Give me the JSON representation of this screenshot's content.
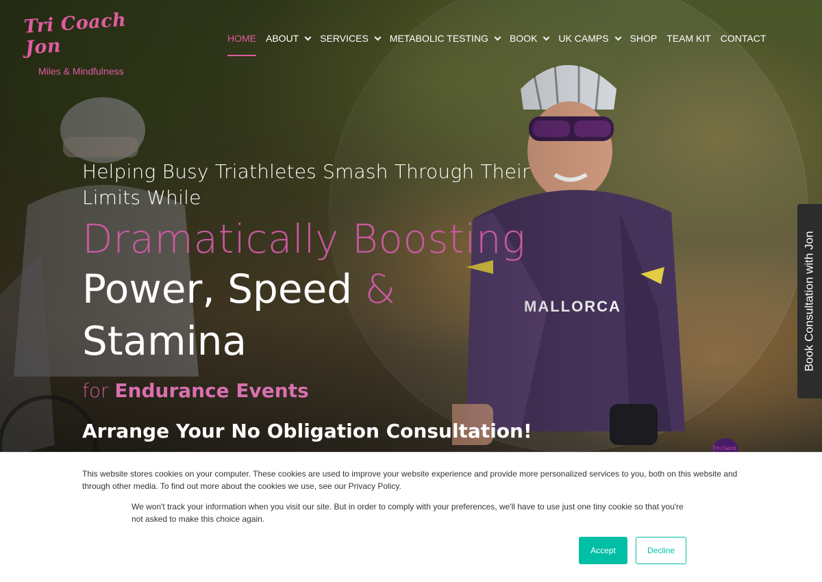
{
  "brand": {
    "logo_text": "Tri Coach Jon",
    "tagline": "Miles & Mindfulness",
    "accent": "#e05ca0",
    "accent_soft": "#c95aa0"
  },
  "nav": {
    "items": [
      {
        "label": "HOME",
        "active": true,
        "has_dropdown": false
      },
      {
        "label": "ABOUT",
        "active": false,
        "has_dropdown": true
      },
      {
        "label": "SERVICES",
        "active": false,
        "has_dropdown": true
      },
      {
        "label": "METABOLIC TESTING",
        "active": false,
        "has_dropdown": true
      },
      {
        "label": "BOOK",
        "active": false,
        "has_dropdown": true
      },
      {
        "label": "UK CAMPS",
        "active": false,
        "has_dropdown": true
      },
      {
        "label": "SHOP",
        "active": false,
        "has_dropdown": false
      },
      {
        "label": "TEAM KIT",
        "active": false,
        "has_dropdown": false
      },
      {
        "label": "CONTACT",
        "active": false,
        "has_dropdown": false
      }
    ]
  },
  "hero": {
    "line1": "Helping Busy Triathletes Smash Through Their",
    "line2": "Limits While",
    "highlight": "Dramatically Boosting",
    "power": "Power, Speed",
    "amp": "&",
    "stamina": "Stamina",
    "for_word": "for",
    "for_bold": "Endurance Events",
    "cta": "Arrange Your No Obligation Consultation!"
  },
  "side_tab": {
    "label": "Book Consultation with Jon"
  },
  "chat_badge": {
    "icon": "logo-chat-icon",
    "text": "Tri Coach Jon"
  },
  "cookie": {
    "text1": "This website stores cookies on your computer. These cookies are used to improve your website experience and provide more personalized services to you, both on this website and through other media. To find out more about the cookies we use, see our Privacy Policy.",
    "text2": "We won't track your information when you visit our site. But in order to comply with your preferences, we'll have to use just one tiny cookie so that you're not asked to make this choice again.",
    "accept_label": "Accept",
    "decline_label": "Decline",
    "button_color": "#00bfa5"
  }
}
